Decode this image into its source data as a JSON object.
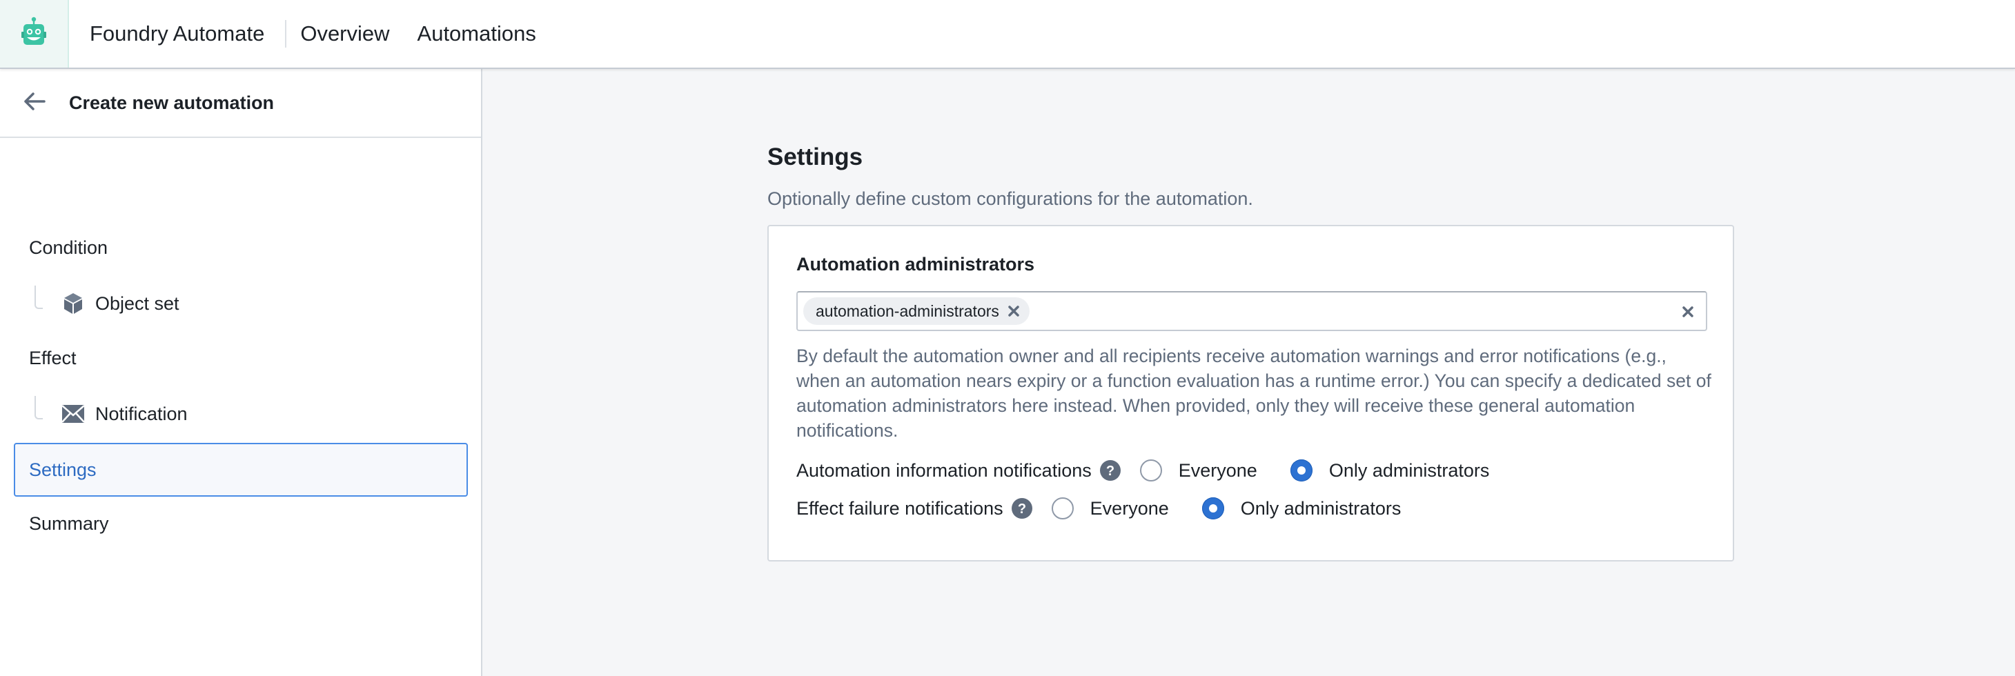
{
  "header": {
    "logo_icon": "robot-icon",
    "app_name": "Foundry Automate",
    "nav": [
      {
        "label": "Overview"
      },
      {
        "label": "Automations"
      }
    ]
  },
  "sidebar": {
    "back_icon": "arrow-left-icon",
    "title": "Create new automation",
    "steps": [
      {
        "label": "Condition",
        "children": [
          {
            "label": "Object set",
            "icon": "cube-icon"
          }
        ]
      },
      {
        "label": "Effect",
        "children": [
          {
            "label": "Notification",
            "icon": "envelope-icon"
          }
        ]
      },
      {
        "label": "Settings",
        "active": true
      },
      {
        "label": "Summary"
      }
    ]
  },
  "main": {
    "title": "Settings",
    "subtitle": "Optionally define custom configurations for the automation.",
    "admins": {
      "label": "Automation administrators",
      "chips": [
        "automation-administrators"
      ],
      "help": "By default the automation owner and all recipients receive automation warnings and error notifications (e.g., when an automation nears expiry or a function evaluation has a runtime error.) You can specify a dedicated set of automation administrators here instead. When provided, only they will receive these general automation notifications."
    },
    "notification_settings": [
      {
        "label": "Automation information notifications",
        "options": [
          "Everyone",
          "Only administrators"
        ],
        "selected": "Only administrators"
      },
      {
        "label": "Effect failure notifications",
        "options": [
          "Everyone",
          "Only administrators"
        ],
        "selected": "Only administrators"
      }
    ]
  },
  "colors": {
    "accent": "#2d72d2",
    "logo": "#3cc4a4",
    "icon_gray": "#5f6b7c"
  }
}
